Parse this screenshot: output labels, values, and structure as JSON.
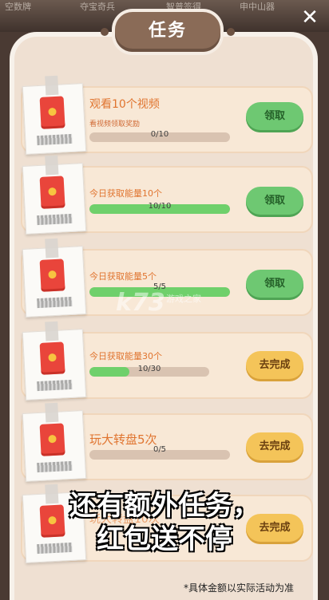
{
  "background": {
    "labels": [
      "空数牌",
      "夺宝奇兵",
      "智普签得",
      "申中山器"
    ]
  },
  "panel": {
    "title": "任务"
  },
  "tasks": [
    {
      "name": "观看10个视频",
      "subtitle": "看视频领取奖励",
      "progress_text": "0/10",
      "progress": 0.0,
      "button": "领取",
      "button_type": "claim"
    },
    {
      "name": "今日获取能量10个",
      "subtitle": "",
      "progress_text": "10/10",
      "progress": 1.0,
      "button": "领取",
      "button_type": "claim"
    },
    {
      "name": "今日获取能量5个",
      "subtitle": "",
      "progress_text": "5/5",
      "progress": 1.0,
      "button": "领取",
      "button_type": "claim"
    },
    {
      "name": "今日获取能量30个",
      "subtitle": "",
      "progress_text": "10/30",
      "progress": 0.333,
      "button": "去完成",
      "button_type": "go"
    },
    {
      "name": "玩大转盘5次",
      "subtitle": "",
      "progress_text": "0/5",
      "progress": 0.0,
      "button": "去完成",
      "button_type": "go"
    },
    {
      "name": "玩大转盘10次",
      "subtitle": "",
      "progress_text": "",
      "progress": 0.0,
      "button": "去完成",
      "button_type": "go"
    }
  ],
  "promo": {
    "line1": "还有额外任务，",
    "line2": "红包送不停"
  },
  "footnote": "*具体金额以实际活动为准",
  "watermark": {
    "logo": "k73",
    "text": "游戏之家"
  },
  "colors": {
    "claim": "#6ec872",
    "go": "#f4c459",
    "progress": "#6fd06b",
    "envelope": "#e9453b"
  }
}
